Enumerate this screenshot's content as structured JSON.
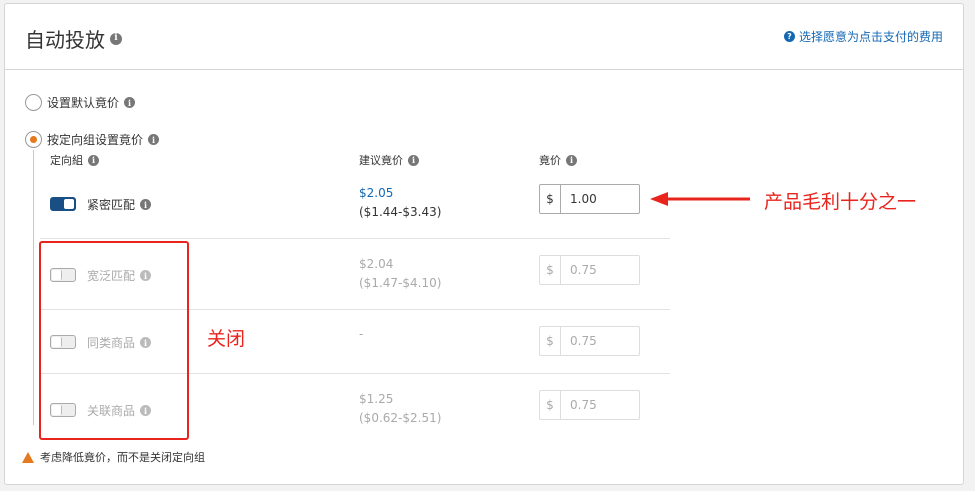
{
  "header": {
    "title": "自动投放",
    "help_link": "选择愿意为点击支付的费用"
  },
  "bid_options": [
    {
      "label": "设置默认竟价",
      "checked": false
    },
    {
      "label": "按定向组设置竟价",
      "checked": true
    }
  ],
  "columns": {
    "group": "定向組",
    "suggested": "建议竟价",
    "bid": "竟价"
  },
  "rows": [
    {
      "label": "紧密匹配",
      "enabled": true,
      "suggested": "$2.05",
      "range": "($1.44-$3.43)",
      "currency": "$",
      "bid": "1.00"
    },
    {
      "label": "宽泛匹配",
      "enabled": false,
      "suggested": "$2.04",
      "range": "($1.47-$4.10)",
      "currency": "$",
      "bid": "0.75"
    },
    {
      "label": "同类商品",
      "enabled": false,
      "suggested": "-",
      "range": "",
      "currency": "$",
      "bid": "0.75"
    },
    {
      "label": "关联商品",
      "enabled": false,
      "suggested": "$1.25",
      "range": "($0.62-$2.51)",
      "currency": "$",
      "bid": "0.75"
    }
  ],
  "warning": "考虑降低竟价，而不是关闭定向组",
  "annotations": {
    "arrow_note": "产品毛利十分之一",
    "box_note": "关闭",
    "color": "#e8241c"
  }
}
